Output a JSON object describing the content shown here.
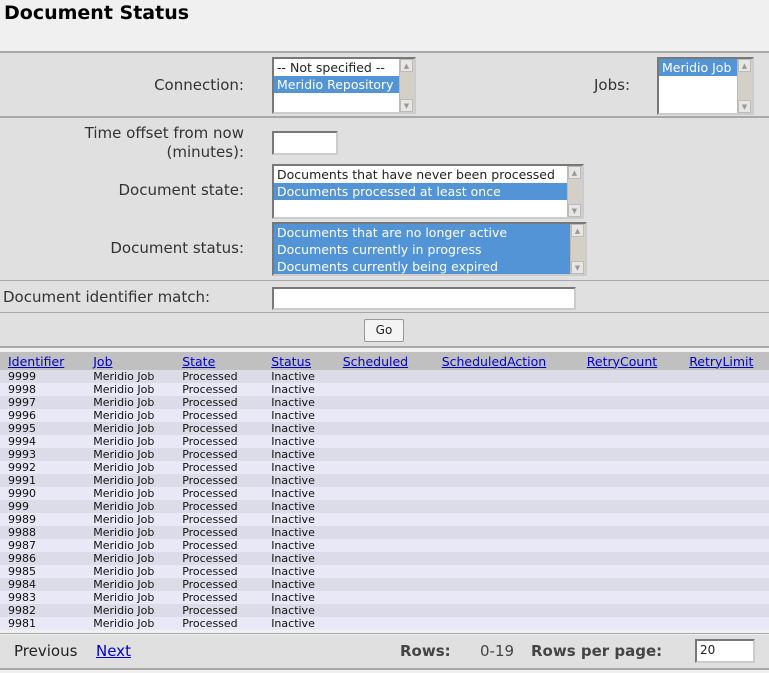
{
  "title": "Document Status",
  "form": {
    "connection_label": "Connection:",
    "connection_options": [
      {
        "label": "-- Not specified --",
        "selected": false
      },
      {
        "label": "Meridio Repository",
        "selected": true
      }
    ],
    "jobs_label": "Jobs:",
    "jobs_options": [
      {
        "label": "Meridio Job",
        "selected": true
      }
    ],
    "time_offset_label_1": "Time offset from now",
    "time_offset_label_2": "(minutes):",
    "time_offset_value": "",
    "document_state_label": "Document state:",
    "document_state_options": [
      {
        "label": "Documents that have never been processed",
        "selected": false
      },
      {
        "label": "Documents processed at least once",
        "selected": true
      }
    ],
    "document_status_label": "Document status:",
    "document_status_options": [
      {
        "label": "Documents that are no longer active",
        "selected": true
      },
      {
        "label": "Documents currently in progress",
        "selected": true
      },
      {
        "label": "Documents currently being expired",
        "selected": true
      }
    ],
    "identifier_match_label": "Document identifier match:",
    "identifier_match_value": "",
    "go_label": "Go"
  },
  "table": {
    "columns": [
      "Identifier",
      "Job",
      "State",
      "Status",
      "Scheduled",
      "ScheduledAction",
      "RetryCount",
      "RetryLimit"
    ],
    "rows": [
      [
        "9999",
        "Meridio Job",
        "Processed",
        "Inactive"
      ],
      [
        "9998",
        "Meridio Job",
        "Processed",
        "Inactive"
      ],
      [
        "9997",
        "Meridio Job",
        "Processed",
        "Inactive"
      ],
      [
        "9996",
        "Meridio Job",
        "Processed",
        "Inactive"
      ],
      [
        "9995",
        "Meridio Job",
        "Processed",
        "Inactive"
      ],
      [
        "9994",
        "Meridio Job",
        "Processed",
        "Inactive"
      ],
      [
        "9993",
        "Meridio Job",
        "Processed",
        "Inactive"
      ],
      [
        "9992",
        "Meridio Job",
        "Processed",
        "Inactive"
      ],
      [
        "9991",
        "Meridio Job",
        "Processed",
        "Inactive"
      ],
      [
        "9990",
        "Meridio Job",
        "Processed",
        "Inactive"
      ],
      [
        "999",
        "Meridio Job",
        "Processed",
        "Inactive"
      ],
      [
        "9989",
        "Meridio Job",
        "Processed",
        "Inactive"
      ],
      [
        "9988",
        "Meridio Job",
        "Processed",
        "Inactive"
      ],
      [
        "9987",
        "Meridio Job",
        "Processed",
        "Inactive"
      ],
      [
        "9986",
        "Meridio Job",
        "Processed",
        "Inactive"
      ],
      [
        "9985",
        "Meridio Job",
        "Processed",
        "Inactive"
      ],
      [
        "9984",
        "Meridio Job",
        "Processed",
        "Inactive"
      ],
      [
        "9983",
        "Meridio Job",
        "Processed",
        "Inactive"
      ],
      [
        "9982",
        "Meridio Job",
        "Processed",
        "Inactive"
      ],
      [
        "9981",
        "Meridio Job",
        "Processed",
        "Inactive"
      ]
    ]
  },
  "footer": {
    "previous": "Previous",
    "next": "Next",
    "rows_label": "Rows:",
    "rows_value": "0-19",
    "rows_per_page_label": "Rows per page:",
    "rows_per_page_value": "20"
  }
}
